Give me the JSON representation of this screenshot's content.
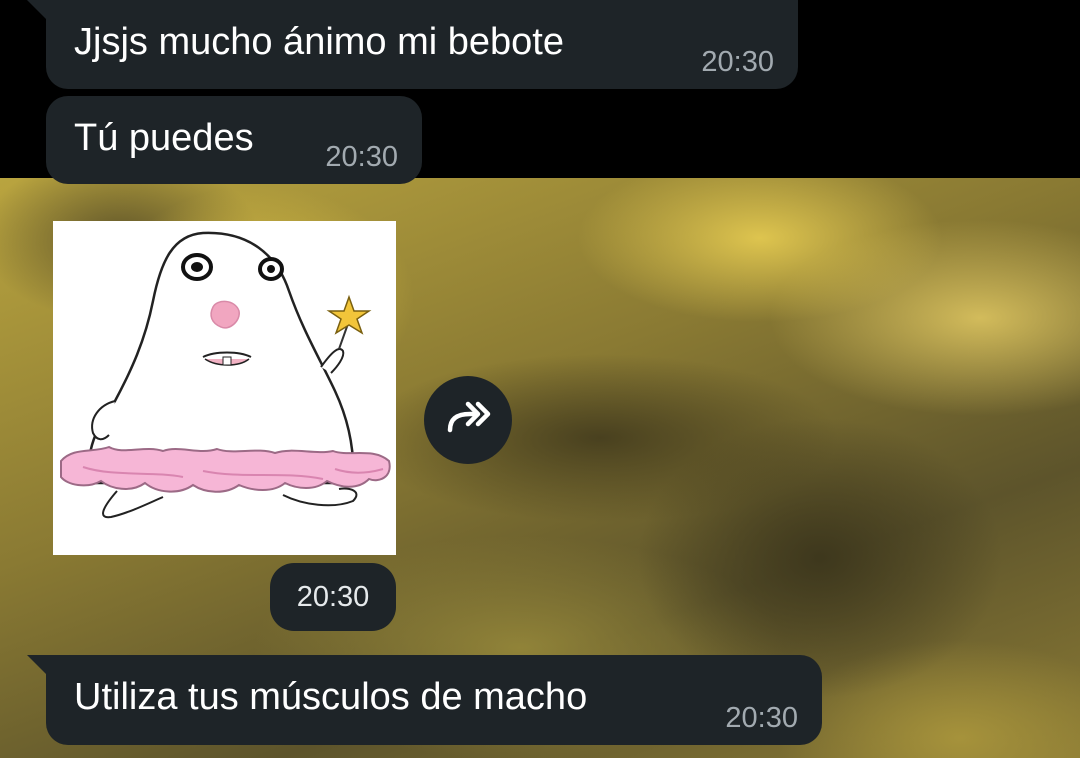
{
  "chat": {
    "messages": [
      {
        "text": "Jjsjs mucho ánimo mi bebote",
        "time": "20:30"
      },
      {
        "text": "Tú puedes",
        "time": "20:30"
      },
      {
        "type": "sticker",
        "time": "20:30",
        "icon": "forward-icon"
      },
      {
        "text": "Utiliza tus músculos de macho",
        "time": "20:30"
      }
    ]
  },
  "colors": {
    "bubble": "#1e2428",
    "time_text": "#a2aab0",
    "message_text": "#ffffff"
  }
}
